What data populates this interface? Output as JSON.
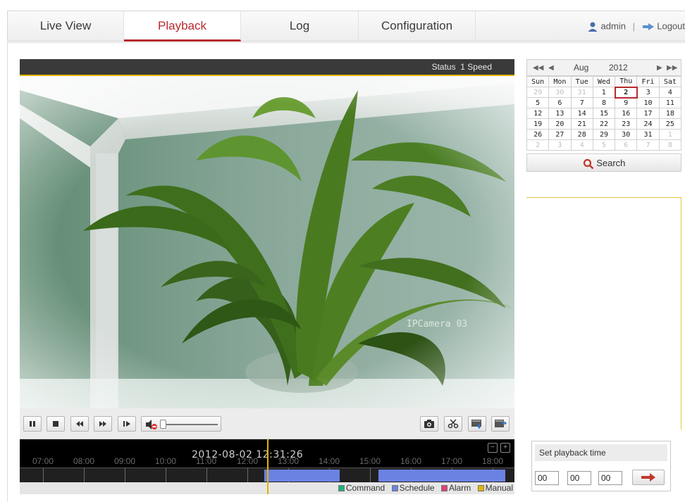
{
  "nav": {
    "tabs": [
      {
        "label": "Live View"
      },
      {
        "label": "Playback"
      },
      {
        "label": "Log"
      },
      {
        "label": "Configuration"
      }
    ],
    "user": "admin",
    "separator": "|",
    "logout": "Logout"
  },
  "status": {
    "label": "Status",
    "speed": "1 Speed"
  },
  "video": {
    "osd": "IPCamera 03"
  },
  "toolbar": {
    "buttons": [
      "pause-icon",
      "stop-icon",
      "slow-down-icon",
      "speed-up-icon",
      "frame-step-icon",
      "mute-icon",
      "capture-icon",
      "clip-icon",
      "download-icon",
      "export-icon"
    ]
  },
  "timeline": {
    "datetime": "2012-08-02 12:31:26",
    "hours": [
      "07:00",
      "08:00",
      "09:00",
      "10:00",
      "11:00",
      "12:00",
      "13:00",
      "14:00",
      "15:00",
      "16:00",
      "17:00",
      "18:00"
    ],
    "legend": [
      "Command",
      "Schedule",
      "Alarm",
      "Manual"
    ],
    "legend_colors": {
      "Command": "#22b07a",
      "Schedule": "#6b82e3",
      "Alarm": "#e0407a",
      "Manual": "#e2b400"
    }
  },
  "calendar": {
    "month": "Aug",
    "year": "2012",
    "weekdays": [
      "Sun",
      "Mon",
      "Tue",
      "Wed",
      "Thu",
      "Fri",
      "Sat"
    ],
    "weeks": [
      [
        "29",
        "30",
        "31",
        "1",
        "2",
        "3",
        "4"
      ],
      [
        "5",
        "6",
        "7",
        "8",
        "9",
        "10",
        "11"
      ],
      [
        "12",
        "13",
        "14",
        "15",
        "16",
        "17",
        "18"
      ],
      [
        "19",
        "20",
        "21",
        "22",
        "23",
        "24",
        "25"
      ],
      [
        "26",
        "27",
        "28",
        "29",
        "30",
        "31",
        "1"
      ],
      [
        "2",
        "3",
        "4",
        "5",
        "6",
        "7",
        "8"
      ]
    ],
    "selected": "2",
    "search_label": "Search"
  },
  "playback_time": {
    "title": "Set playback time",
    "hour": "00",
    "minute": "00",
    "second": "00"
  },
  "colors": {
    "accent": "#b8292e",
    "highlight": "#e2b400",
    "schedule": "#6b82e3"
  }
}
